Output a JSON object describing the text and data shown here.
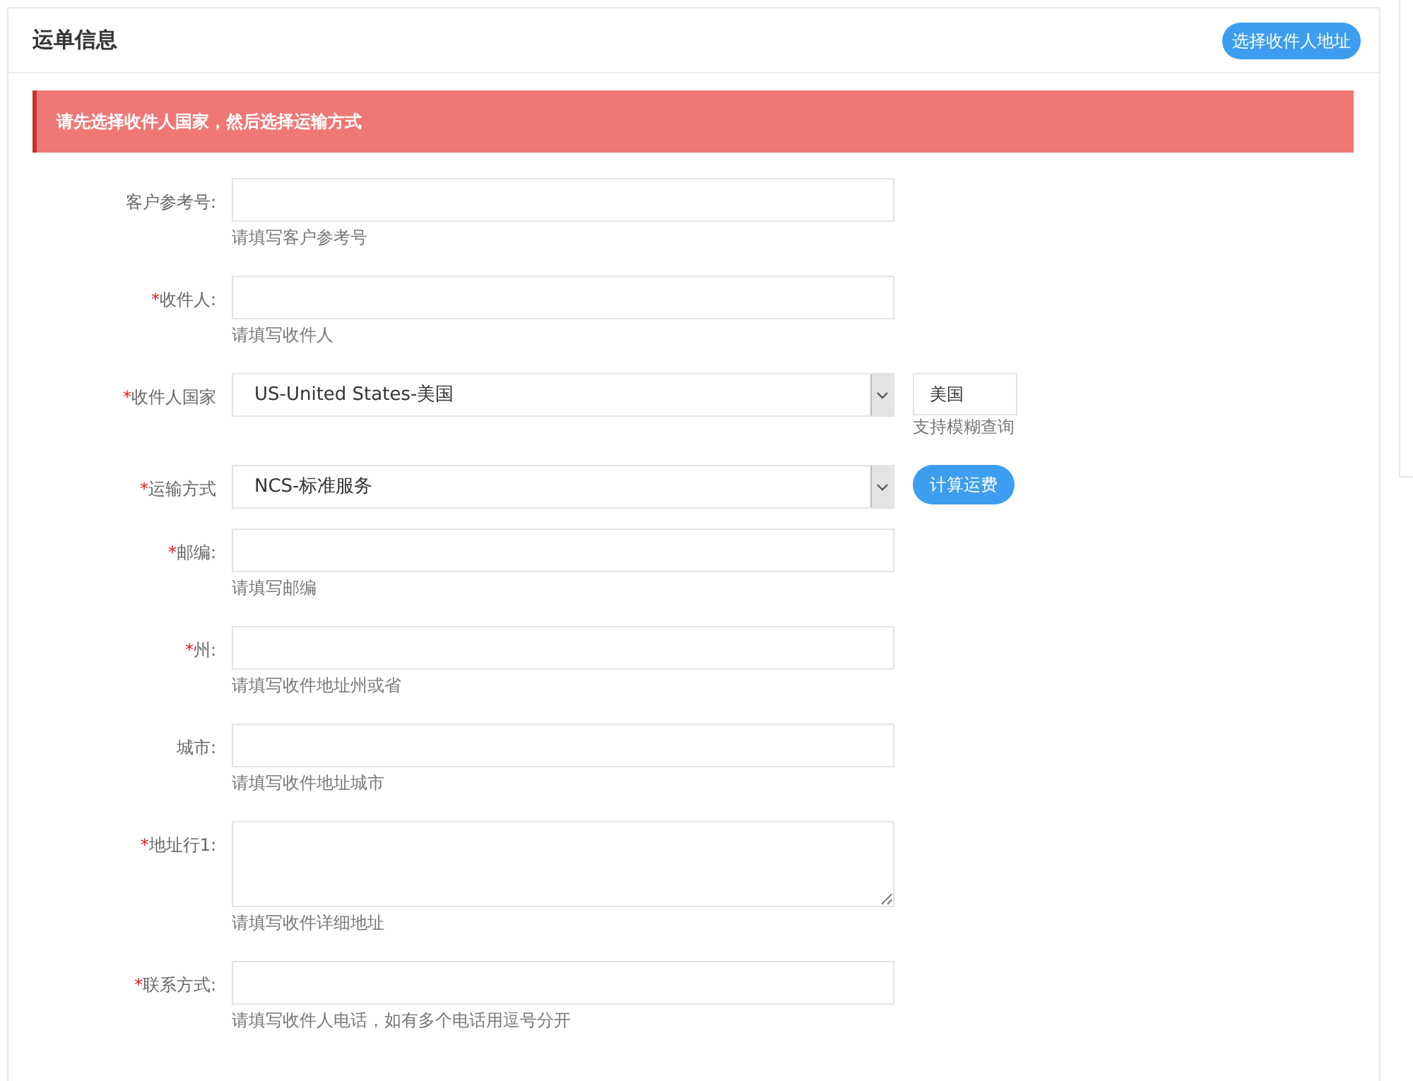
{
  "panel": {
    "title": "运单信息",
    "header_button": "选择收件人地址"
  },
  "alert": {
    "text": "请先选择收件人国家，然后选择运输方式"
  },
  "fields": [
    {
      "kind": "text",
      "label": "客户参考号:",
      "hint": "请填写客户参考号"
    },
    {
      "kind": "text",
      "required_mark": "*",
      "label": "收件人:",
      "hint": "请填写收件人"
    },
    {
      "kind": "select",
      "required_mark": "*",
      "label": "收件人国家",
      "value": "US-United States-美国",
      "search_value": "美国",
      "search_hint": "支持模糊查询"
    },
    {
      "kind": "select",
      "required_mark": "*",
      "label": "运输方式",
      "value": "NCS-标准服务",
      "action_button": "计算运费"
    },
    {
      "kind": "text",
      "required_mark": "*",
      "label": "邮编:",
      "hint": "请填写邮编"
    },
    {
      "kind": "text",
      "required_mark": "*",
      "label": "州:",
      "hint": "请填写收件地址州或省"
    },
    {
      "kind": "text",
      "label": "城市:",
      "hint": "请填写收件地址城市"
    },
    {
      "kind": "textarea",
      "required_mark": "*",
      "label": "地址行1:",
      "hint": "请填写收件详细地址"
    },
    {
      "kind": "text",
      "required_mark": "*",
      "label": "联系方式:",
      "hint": "请填写收件人电话，如有多个电话用逗号分开"
    }
  ]
}
